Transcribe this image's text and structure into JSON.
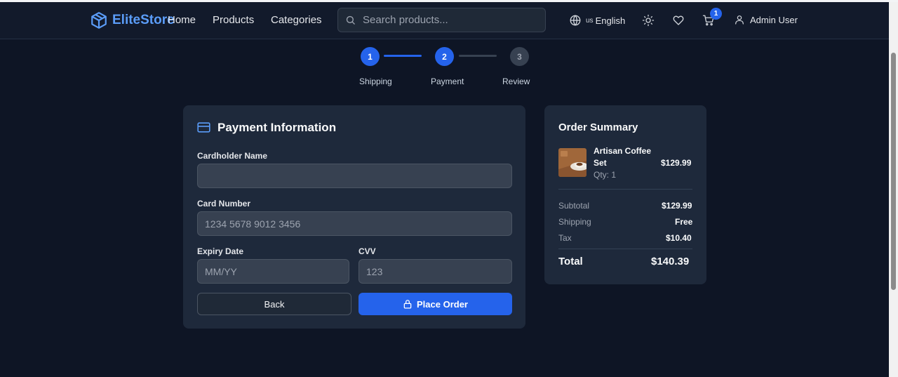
{
  "header": {
    "brand": "EliteStore",
    "nav": [
      "Home",
      "Products",
      "Categories"
    ],
    "search_placeholder": "Search products...",
    "lang_flag": "us",
    "lang_label": "English",
    "cart_count": "1",
    "user_name": "Admin User"
  },
  "steps": [
    {
      "num": "1",
      "label": "Shipping"
    },
    {
      "num": "2",
      "label": "Payment"
    },
    {
      "num": "3",
      "label": "Review"
    }
  ],
  "payment": {
    "title": "Payment Information",
    "cardholder_label": "Cardholder Name",
    "cardholder_value": "",
    "card_number_label": "Card Number",
    "card_number_placeholder": "1234 5678 9012 3456",
    "expiry_label": "Expiry Date",
    "expiry_placeholder": "MM/YY",
    "cvv_label": "CVV",
    "cvv_placeholder": "123",
    "back_label": "Back",
    "order_label": "Place Order"
  },
  "summary": {
    "title": "Order Summary",
    "item_name_line1": "Artisan Coffee",
    "item_name_line2": "Set",
    "item_qty": "Qty: 1",
    "item_price": "$129.99",
    "subtotal_label": "Subtotal",
    "subtotal_value": "$129.99",
    "shipping_label": "Shipping",
    "shipping_value": "Free",
    "tax_label": "Tax",
    "tax_value": "$10.40",
    "total_label": "Total",
    "total_value": "$140.39"
  },
  "colors": {
    "accent": "#2563eb",
    "brand": "#5b9df9",
    "background": "#0e1525",
    "card": "#1e293b"
  },
  "icons": [
    "package-icon",
    "search-icon",
    "globe-icon",
    "sun-icon",
    "heart-icon",
    "cart-icon",
    "user-icon",
    "credit-card-icon",
    "lock-icon"
  ]
}
